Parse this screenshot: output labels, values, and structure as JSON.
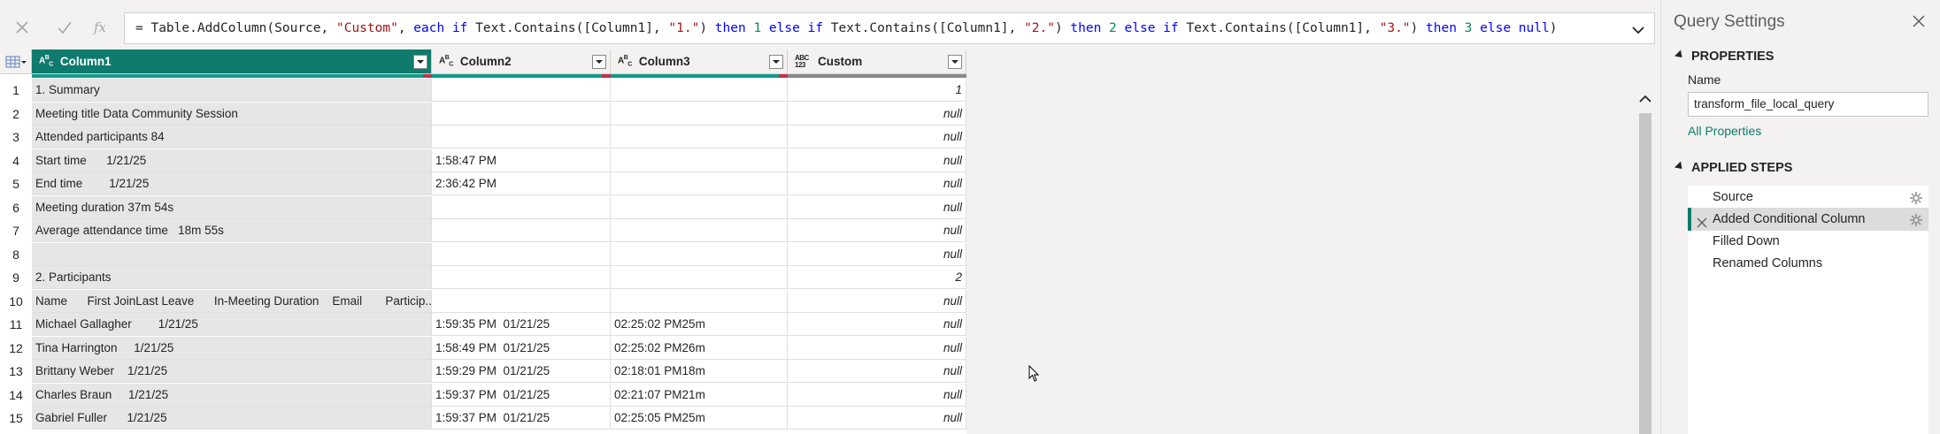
{
  "formula": {
    "tokens": [
      {
        "t": "= Table.AddColumn(Source, ",
        "k": "plain"
      },
      {
        "t": "\"Custom\"",
        "k": "str"
      },
      {
        "t": ", ",
        "k": "plain"
      },
      {
        "t": "each if",
        "k": "kw"
      },
      {
        "t": " Text.Contains([Column1], ",
        "k": "plain"
      },
      {
        "t": "\"1.\"",
        "k": "str"
      },
      {
        "t": ") ",
        "k": "plain"
      },
      {
        "t": "then",
        "k": "kw"
      },
      {
        "t": " ",
        "k": "plain"
      },
      {
        "t": "1",
        "k": "num"
      },
      {
        "t": " ",
        "k": "plain"
      },
      {
        "t": "else if",
        "k": "kw"
      },
      {
        "t": " Text.Contains([Column1], ",
        "k": "plain"
      },
      {
        "t": "\"2.\"",
        "k": "str"
      },
      {
        "t": ") ",
        "k": "plain"
      },
      {
        "t": "then",
        "k": "kw"
      },
      {
        "t": " ",
        "k": "plain"
      },
      {
        "t": "2",
        "k": "num"
      },
      {
        "t": " ",
        "k": "plain"
      },
      {
        "t": "else if",
        "k": "kw"
      },
      {
        "t": " Text.Contains([Column1], ",
        "k": "plain"
      },
      {
        "t": "\"3.\"",
        "k": "str"
      },
      {
        "t": ") ",
        "k": "plain"
      },
      {
        "t": "then",
        "k": "kw"
      },
      {
        "t": " ",
        "k": "plain"
      },
      {
        "t": "3",
        "k": "num"
      },
      {
        "t": " ",
        "k": "plain"
      },
      {
        "t": "else",
        "k": "kw"
      },
      {
        "t": " ",
        "k": "plain"
      },
      {
        "t": "null",
        "k": "kw"
      },
      {
        "t": ")",
        "k": "plain"
      }
    ],
    "icons": {
      "cancel": "close-icon",
      "commit": "check-icon",
      "fx": "fx-icon",
      "expand": "chevron-down-icon"
    }
  },
  "grid": {
    "columns": [
      {
        "name": "Column1",
        "type": "ABC",
        "selected": true
      },
      {
        "name": "Column2",
        "type": "ABC",
        "selected": false
      },
      {
        "name": "Column3",
        "type": "ABC",
        "selected": false
      },
      {
        "name": "Custom",
        "type": "ABC 123",
        "selected": false
      }
    ],
    "rows": [
      {
        "n": "1",
        "c1": "1. Summary",
        "c2": "",
        "c3": "",
        "c4": "1"
      },
      {
        "n": "2",
        "c1": "Meeting title Data Community Session",
        "c2": "",
        "c3": "",
        "c4": "null"
      },
      {
        "n": "3",
        "c1": "Attended participants 84",
        "c2": "",
        "c3": "",
        "c4": "null"
      },
      {
        "n": "4",
        "c1": "Start time      1/21/25",
        "c2": "1:58:47 PM",
        "c3": "",
        "c4": "null"
      },
      {
        "n": "5",
        "c1": "End time        1/21/25",
        "c2": "2:36:42 PM",
        "c3": "",
        "c4": "null"
      },
      {
        "n": "6",
        "c1": "Meeting duration 37m 54s",
        "c2": "",
        "c3": "",
        "c4": "null"
      },
      {
        "n": "7",
        "c1": "Average attendance time   18m 55s",
        "c2": "",
        "c3": "",
        "c4": "null"
      },
      {
        "n": "8",
        "c1": "",
        "c2": "",
        "c3": "",
        "c4": "null"
      },
      {
        "n": "9",
        "c1": "2. Participants",
        "c2": "",
        "c3": "",
        "c4": "2"
      },
      {
        "n": "10",
        "c1": "Name      First JoinLast Leave      In-Meeting Duration    Email       Particip...",
        "c2": "",
        "c3": "",
        "c4": "null"
      },
      {
        "n": "11",
        "c1": "Michael Gallagher        1/21/25",
        "c2": "1:59:35 PM  01/21/25",
        "c3": "02:25:02 PM25m",
        "c4": "null"
      },
      {
        "n": "12",
        "c1": "Tina Harrington     1/21/25",
        "c2": "1:58:49 PM  01/21/25",
        "c3": "02:25:02 PM26m",
        "c4": "null"
      },
      {
        "n": "13",
        "c1": "Brittany Weber    1/21/25",
        "c2": "1:59:29 PM  01/21/25",
        "c3": "02:18:01 PM18m",
        "c4": "null"
      },
      {
        "n": "14",
        "c1": "Charles Braun     1/21/25",
        "c2": "1:59:37 PM  01/21/25",
        "c3": "02:21:07 PM21m",
        "c4": "null"
      },
      {
        "n": "15",
        "c1": "Gabriel Fuller      1/21/25",
        "c2": "1:59:37 PM  01/21/25",
        "c3": "02:25:05 PM25m",
        "c4": "null"
      }
    ]
  },
  "panel": {
    "title": "Query Settings",
    "properties_title": "PROPERTIES",
    "name_label": "Name",
    "name_value": "transform_file_local_query",
    "all_properties": "All Properties",
    "steps_title": "APPLIED STEPS",
    "steps": [
      {
        "label": "Source",
        "active": false,
        "gear": true
      },
      {
        "label": "Added Conditional Column",
        "active": true,
        "gear": true
      },
      {
        "label": "Filled Down",
        "active": false,
        "gear": false
      },
      {
        "label": "Renamed Columns",
        "active": false,
        "gear": false
      }
    ]
  },
  "colors": {
    "accent": "#0f7b6c",
    "selected_header": "#0f7b6c",
    "quality_bar": "#0f9d8a",
    "error_bar": "#c4314b"
  }
}
